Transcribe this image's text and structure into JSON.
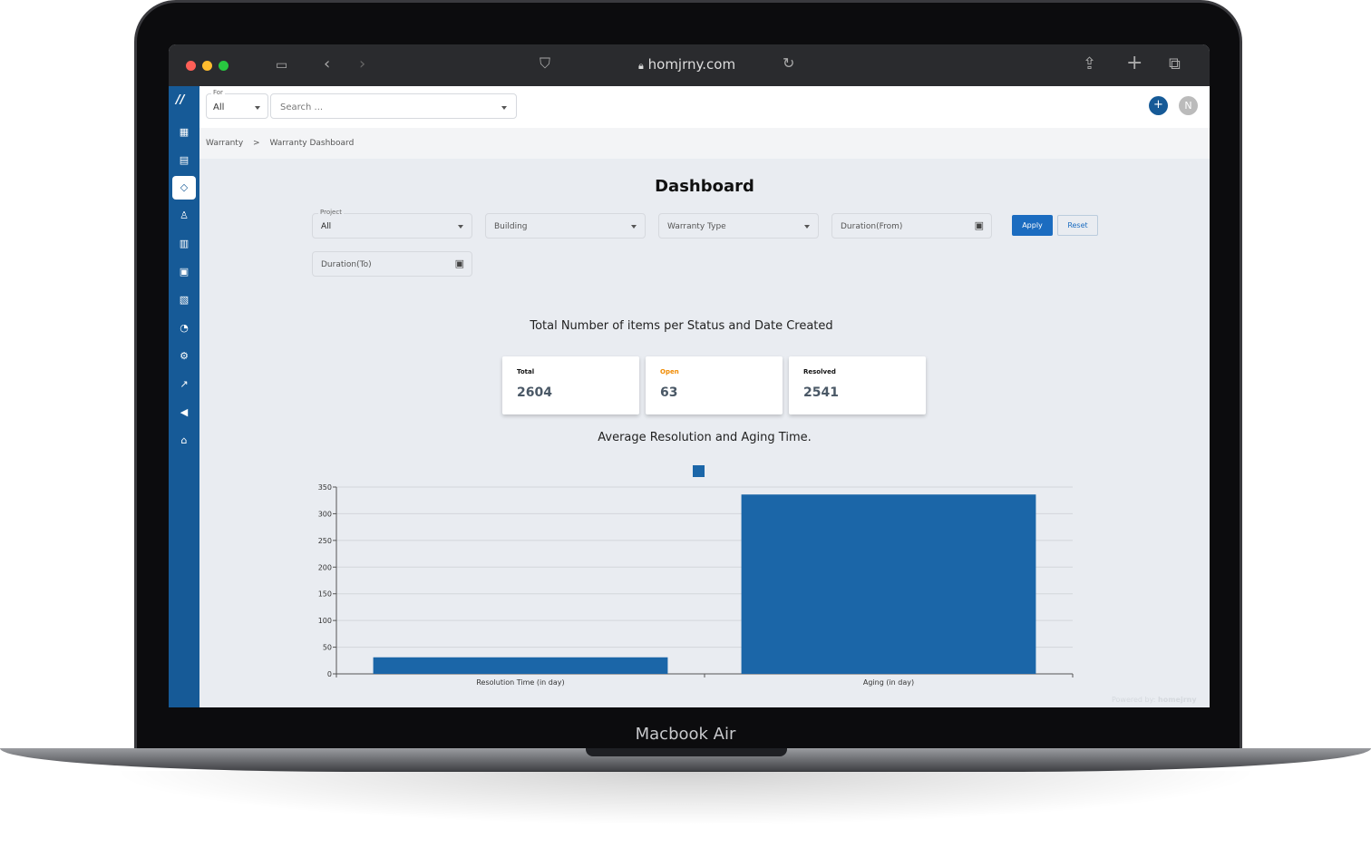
{
  "device": {
    "model": "Macbook Air"
  },
  "browser": {
    "url": "homjrny.com",
    "icons": [
      "sidebar-icon",
      "back-icon",
      "forward-icon",
      "shield-icon",
      "lock-icon",
      "reload-icon",
      "share-icon",
      "new-tab-icon",
      "tabs-icon"
    ]
  },
  "topbar": {
    "for_label": "For",
    "for_value": "All",
    "search_placeholder": "Search ...",
    "add_label": "+",
    "avatar": "N"
  },
  "sidebar": {
    "items": [
      "dashboard",
      "documents",
      "warranty",
      "users",
      "reports",
      "buildings",
      "files",
      "support",
      "settings",
      "analytics",
      "announcements",
      "home"
    ],
    "active": "warranty"
  },
  "breadcrumb": {
    "items": [
      "Warranty",
      "Warranty Dashboard"
    ],
    "separator": ">"
  },
  "page": {
    "title": "Dashboard"
  },
  "filters": {
    "project_label": "Project",
    "project_value": "All",
    "building": "Building",
    "warranty_type": "Warranty Type",
    "duration_from": "Duration(From)",
    "duration_to": "Duration(To)",
    "apply": "Apply",
    "reset": "Reset"
  },
  "status": {
    "heading": "Total Number of items per Status and Date Created",
    "cards": [
      {
        "label": "Total",
        "value": "2604",
        "color": "#111111"
      },
      {
        "label": "Open",
        "value": "63",
        "color": "#f08a00"
      },
      {
        "label": "Resolved",
        "value": "2541",
        "color": "#111111"
      }
    ]
  },
  "footer": {
    "powered": "Powered by:",
    "brand": "homejrny"
  },
  "chart_data": {
    "type": "bar",
    "title": "Average Resolution and Aging Time.",
    "categories": [
      "Resolution Time (in day)",
      "Aging (in day)"
    ],
    "values": [
      31,
      336
    ],
    "ylim": [
      0,
      350
    ],
    "yticks": [
      0,
      50,
      100,
      150,
      200,
      250,
      300,
      350
    ],
    "grid": true,
    "legend": "top-center",
    "color": "#1b66a8"
  }
}
